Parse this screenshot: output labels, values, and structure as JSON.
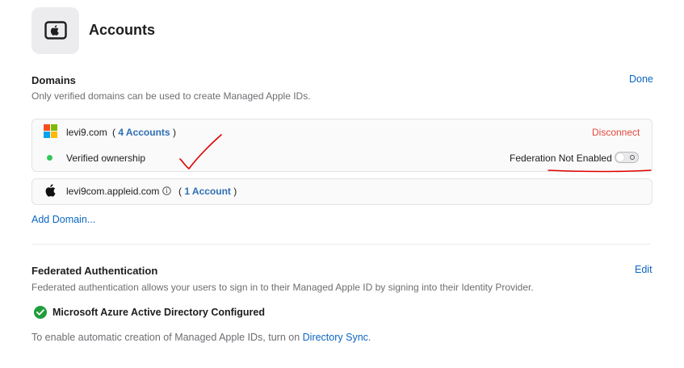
{
  "page": {
    "title": "Accounts"
  },
  "domains": {
    "title": "Domains",
    "done_label": "Done",
    "description": "Only verified domains can be used to create Managed Apple IDs.",
    "items": [
      {
        "name": "levi9.com",
        "count_open": "(",
        "count_label": "4 Accounts",
        "count_close": ")",
        "action": "Disconnect",
        "status": "Verified ownership",
        "federation_label": "Federation Not Enabled",
        "federation_enabled": false
      },
      {
        "name": "levi9com.appleid.com",
        "count_open": "(",
        "count_label": "1 Account",
        "count_close": ")"
      }
    ],
    "add_label": "Add Domain..."
  },
  "federated": {
    "title": "Federated Authentication",
    "edit_label": "Edit",
    "description": "Federated authentication allows your users to sign in to their Managed Apple ID by signing into their Identity Provider.",
    "configured_label": "Microsoft Azure Active Directory Configured",
    "sync_prefix": "To enable automatic creation of Managed Apple IDs, turn on ",
    "sync_link": "Directory Sync",
    "sync_suffix": "."
  },
  "colors": {
    "accent": "#0a66c2",
    "danger": "#e2483d",
    "success": "#34c759",
    "annotation": "#e00000"
  }
}
